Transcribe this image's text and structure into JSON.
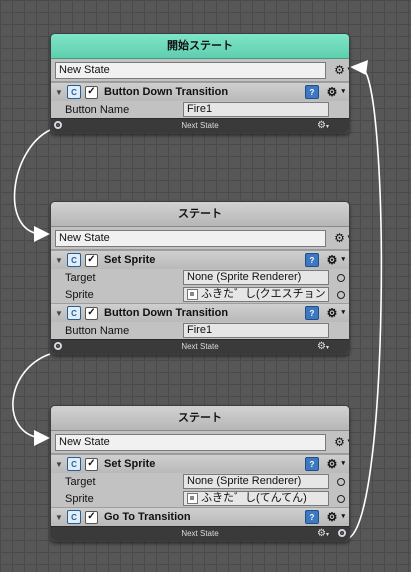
{
  "nodes": [
    {
      "title": "開始ステート",
      "state_name": "New State",
      "components": [
        {
          "title": "Button Down Transition",
          "props": [
            {
              "label": "Button Name",
              "value": "Fire1"
            }
          ]
        }
      ],
      "footer": "Next State"
    },
    {
      "title": "ステート",
      "state_name": "New State",
      "components": [
        {
          "title": "Set Sprite",
          "props": [
            {
              "label": "Target",
              "value": "None (Sprite Renderer)"
            },
            {
              "label": "Sprite",
              "value": "ふきた゛し(クエスチョン"
            }
          ]
        },
        {
          "title": "Button Down Transition",
          "props": [
            {
              "label": "Button Name",
              "value": "Fire1"
            }
          ]
        }
      ],
      "footer": "Next State"
    },
    {
      "title": "ステート",
      "state_name": "New State",
      "components": [
        {
          "title": "Set Sprite",
          "props": [
            {
              "label": "Target",
              "value": "None (Sprite Renderer)"
            },
            {
              "label": "Sprite",
              "value": "ふきた゛し(てんてん)"
            }
          ]
        },
        {
          "title": "Go To Transition",
          "props": []
        }
      ],
      "footer": "Next State"
    }
  ],
  "icons": {
    "gear": "gear-icon",
    "help": "help-book-icon",
    "script": "script-icon",
    "fold": "triangle-down-icon",
    "check": "checkbox-icon",
    "picker": "object-picker-icon",
    "port": "connection-port-icon"
  },
  "colors": {
    "start_header": "#6fdcbc",
    "node_body": "#c2c2c2",
    "footer": "#3a3a3a",
    "wire": "#ffffff",
    "grid_bg": "#575757"
  }
}
